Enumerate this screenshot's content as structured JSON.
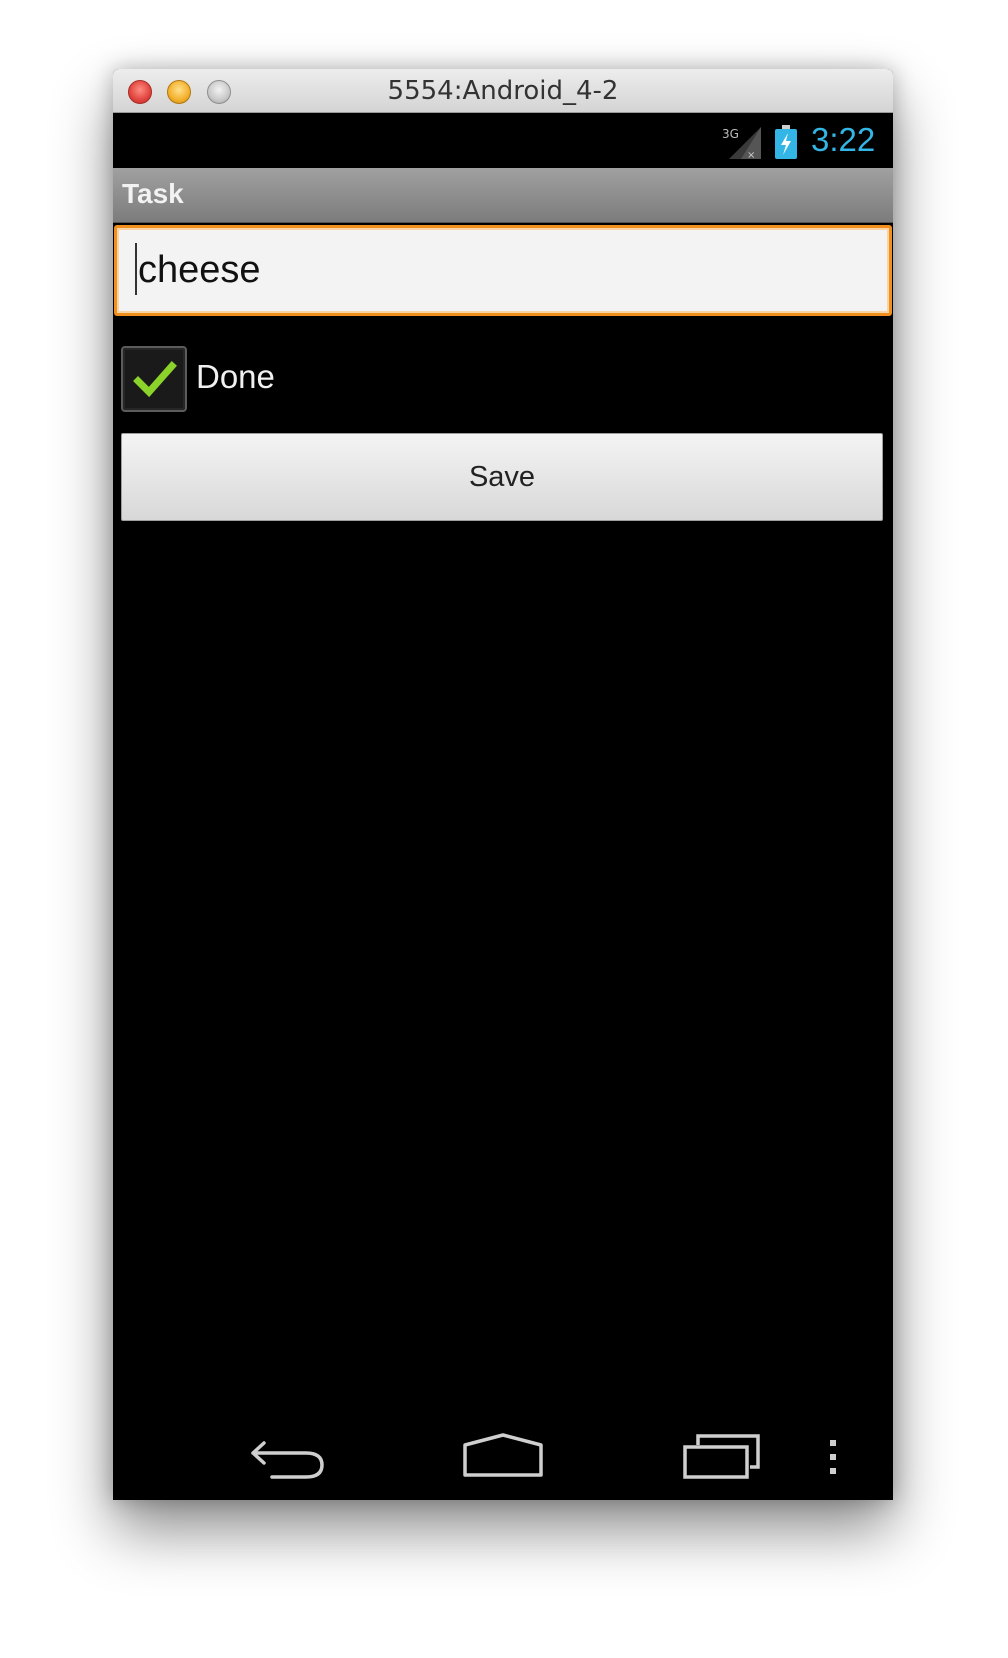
{
  "window": {
    "title": "5554:Android_4-2"
  },
  "status_bar": {
    "network_label": "3G",
    "clock": "3:22",
    "clock_color": "#33b5e5"
  },
  "action_bar": {
    "title": "Task"
  },
  "form": {
    "task_value": "cheese",
    "done_label": "Done",
    "done_checked": true,
    "save_label": "Save"
  },
  "nav_bar": {
    "icons": [
      "back-icon",
      "home-icon",
      "recent-apps-icon",
      "overflow-menu-icon"
    ]
  },
  "colors": {
    "focus_border": "#f08e1e",
    "check_mark": "#8bd32a"
  }
}
